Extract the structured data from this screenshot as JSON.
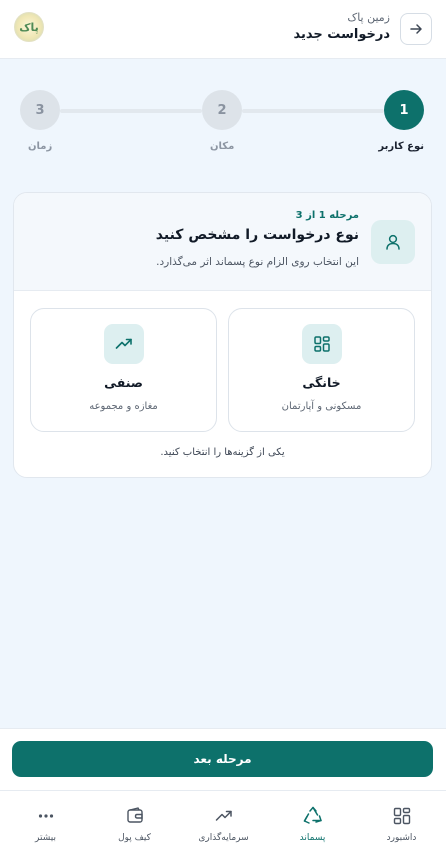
{
  "header": {
    "subtitle": "زمین پاک",
    "title": "درخواست جدید",
    "logo_text": "پاک"
  },
  "stepper": {
    "steps": [
      {
        "number": "1",
        "label": "نوع کاربر",
        "state": "active"
      },
      {
        "number": "2",
        "label": "مکان",
        "state": "pending"
      },
      {
        "number": "3",
        "label": "زمان",
        "state": "pending"
      }
    ]
  },
  "card": {
    "step_of": "مرحله 1 از 3",
    "title": "نوع درخواست را مشخص کنید",
    "description": "این انتخاب روی الزام نوع پسماند اثر می‌گذارد.",
    "options": [
      {
        "title": "خانگی",
        "subtitle": "مسکونی و آپارتمان",
        "icon": "grid-icon"
      },
      {
        "title": "صنفی",
        "subtitle": "مغازه و مجموعه",
        "icon": "trend-up-icon"
      }
    ],
    "hint": "یکی از گزینه‌ها را انتخاب کنید."
  },
  "cta": {
    "label": "مرحله بعد"
  },
  "nav": {
    "items": [
      {
        "label": "داشبورد",
        "icon": "dashboard-icon"
      },
      {
        "label": "پسماند",
        "icon": "recycle-icon",
        "active": true
      },
      {
        "label": "سرمایه‌گذاری",
        "icon": "trend-up-icon"
      },
      {
        "label": "کیف پول",
        "icon": "wallet-icon"
      },
      {
        "label": "بیشتر",
        "icon": "more-icon"
      }
    ]
  },
  "colors": {
    "primary": "#0d716b",
    "background": "#eff6fd",
    "icon_tint": "#ddeff0"
  }
}
